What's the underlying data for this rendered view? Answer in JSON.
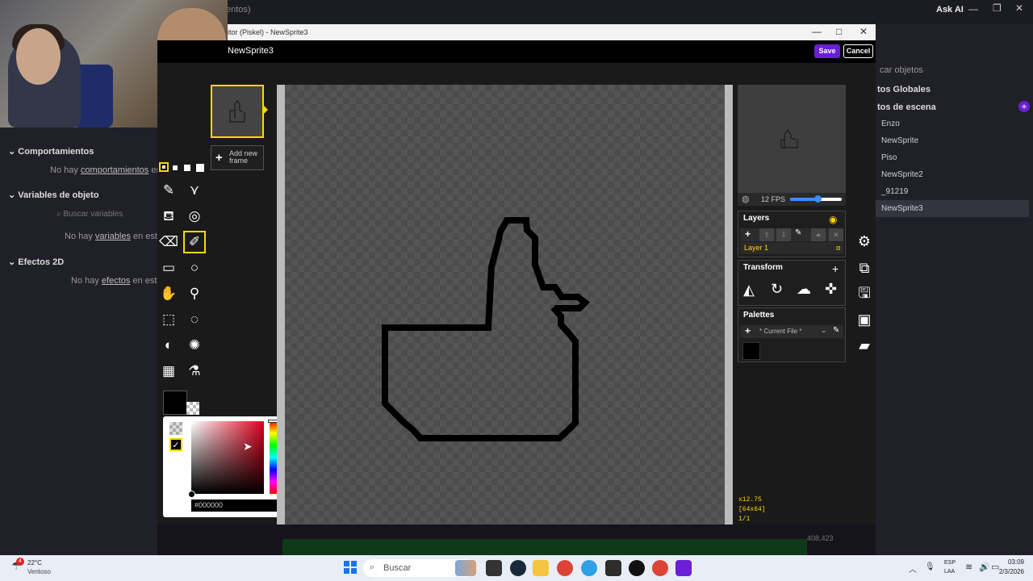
{
  "host": {
    "tab_fragment": "entos)",
    "ask_ai": "Ask AI",
    "behaviors": {
      "header": "Comportamientos",
      "empty_prefix": "No hay ",
      "empty_link": "comportamientos",
      "empty_suffix": " en es"
    },
    "variables": {
      "header": "Variables de objeto",
      "search_placeholder": "Buscar variables",
      "empty_prefix": "No hay ",
      "empty_link": "variables",
      "empty_suffix": " en este ol"
    },
    "effects": {
      "header": "Efectos 2D",
      "empty_prefix": "No hay ",
      "empty_link": "efectos",
      "empty_suffix": " en esta ca"
    },
    "objects": {
      "search_placeholder": "car objetos",
      "global_header": "tos Globales",
      "scene_header": "tos de escena",
      "items": [
        "Enzo",
        "NewSprite",
        "Piso",
        "NewSprite2",
        "_91219",
        "NewSprite3"
      ],
      "selected_index": 5
    },
    "bottom_value": "408,423"
  },
  "piskel": {
    "window_title": "itor (Piskel) - NewSprite3",
    "sprite_name": "NewSprite3",
    "save_label": "Save",
    "cancel_label": "Cancel",
    "add_frame_line1": "Add new",
    "add_frame_line2": "frame",
    "fps_label": "12 FPS",
    "fps_value": 12,
    "layers": {
      "title": "Layers",
      "layer_name": "Layer 1",
      "opacity": "α"
    },
    "transform": {
      "title": "Transform"
    },
    "palettes": {
      "title": "Palettes",
      "current": "* Current File *"
    },
    "color_hex": "#000000",
    "primary_color": "#000000",
    "coords": {
      "cursor": "x12.75",
      "size": "[64x64]",
      "frame": "1/1"
    }
  },
  "taskbar": {
    "weather_temp": "22°C",
    "weather_desc": "Ventoso",
    "search_label": "Buscar",
    "lang_line1": "ESP",
    "lang_line2": "LAA",
    "time": "03:09",
    "date": "2/3/2026",
    "notif_count": "4"
  },
  "colors": {
    "accent": "#ffd700",
    "save": "#6a1fd6"
  }
}
